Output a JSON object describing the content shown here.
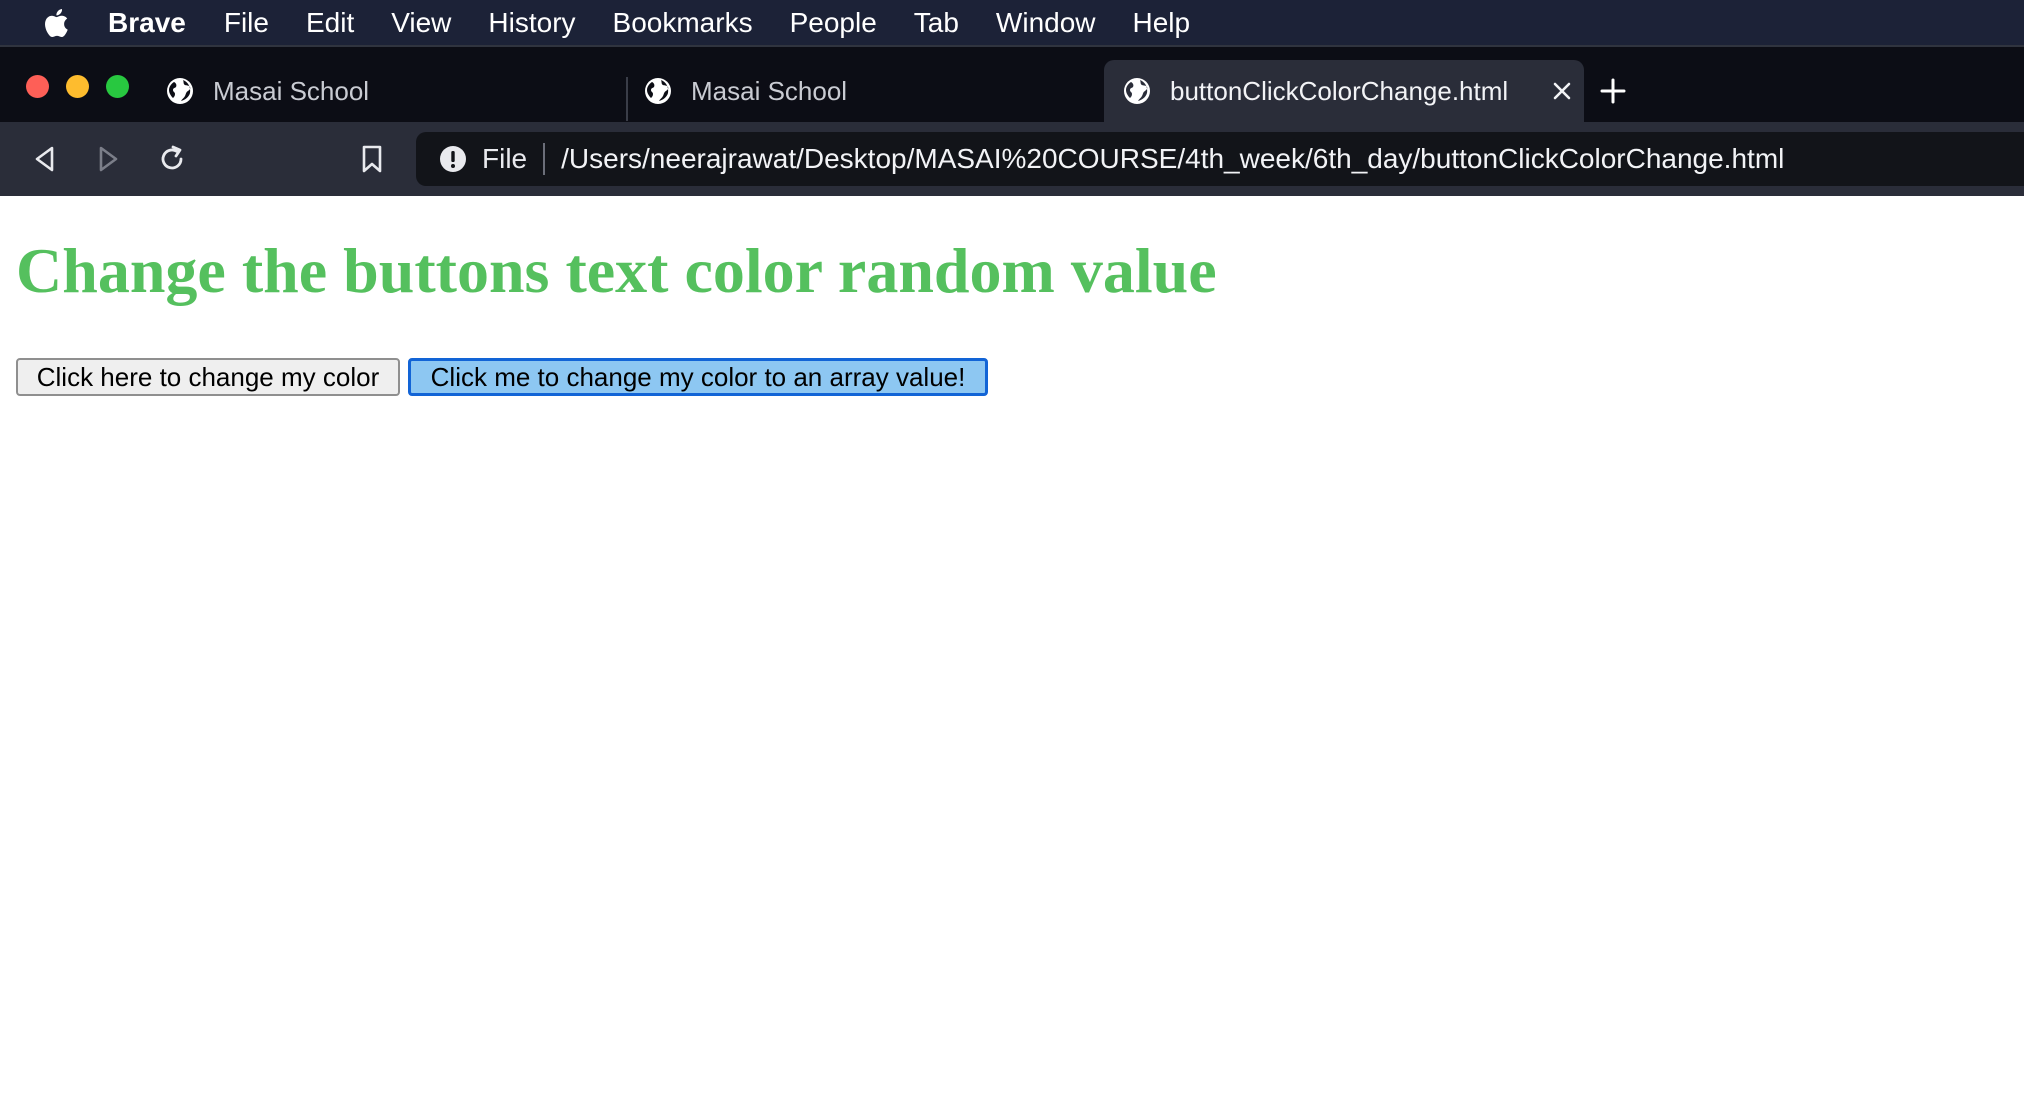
{
  "menubar": {
    "app_name": "Brave",
    "items": [
      "File",
      "Edit",
      "View",
      "History",
      "Bookmarks",
      "People",
      "Tab",
      "Window",
      "Help"
    ]
  },
  "tabs": [
    {
      "title": "Masai School",
      "active": false
    },
    {
      "title": "Masai School",
      "active": false
    },
    {
      "title": "buttonClickColorChange.html",
      "active": true
    }
  ],
  "toolbar": {
    "url_scheme": "File",
    "url_path": "/Users/neerajrawat/Desktop/MASAI%20COURSE/4th_week/6th_day/buttonClickColorChange.html"
  },
  "page": {
    "heading": "Change the buttons text color random value",
    "heading_color": "#55c05e",
    "button_random": "Click here to change my color",
    "button_array": "Click me to change my color to an array value!",
    "button_array_bg": "#8dc7f2"
  },
  "colors": {
    "menubar_bg": "#1c2237",
    "tabstrip_bg": "#0c0d15",
    "toolbar_bg": "#2a2d39",
    "focus_ring": "#1264d6"
  }
}
